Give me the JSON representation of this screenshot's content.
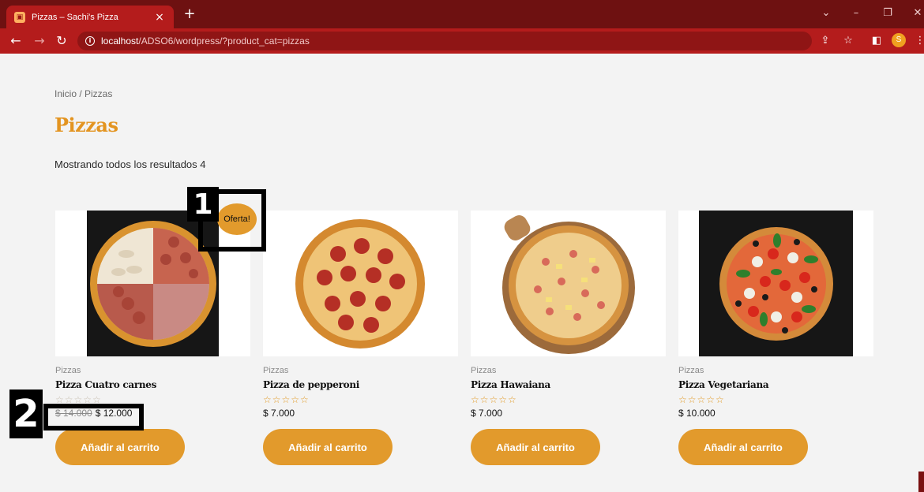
{
  "browser": {
    "tab_title": "Pizzas – Sachi's Pizza",
    "tab_close": "×",
    "new_tab": "+",
    "url_host": "localhost",
    "url_path": "/ADSO6/wordpress/?product_cat=pizzas",
    "profile_initial": "S",
    "colors": {
      "tabbar": "#6e1111",
      "toolbar": "#b41c1c"
    }
  },
  "page": {
    "breadcrumb": "Inicio / Pizzas",
    "title": "Pizzas",
    "result_count": "Mostrando todos los resultados 4",
    "sale_badge": "Oferta!",
    "accent_color": "#e29a2c",
    "products": [
      {
        "category": "Pizzas",
        "name": "Pizza Cuatro carnes",
        "old_price": "$ 14.000",
        "price": "$ 12.000",
        "button": "Añadir al carrito",
        "on_sale": true
      },
      {
        "category": "Pizzas",
        "name": "Pizza de pepperoni",
        "price": "$ 7.000",
        "button": "Añadir al carrito"
      },
      {
        "category": "Pizzas",
        "name": "Pizza Hawaiana",
        "price": "$ 7.000",
        "button": "Añadir al carrito"
      },
      {
        "category": "Pizzas",
        "name": "Pizza Vegetariana",
        "price": "$ 10.000",
        "button": "Añadir al carrito"
      }
    ]
  },
  "annotations": {
    "one": "1",
    "two": "2"
  }
}
